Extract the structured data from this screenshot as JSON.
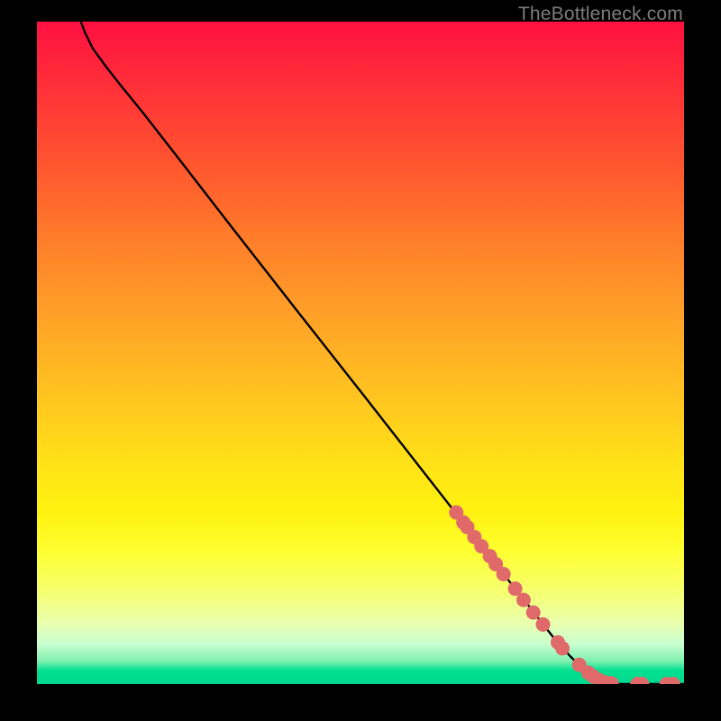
{
  "attribution": "TheBottleneck.com",
  "chart_data": {
    "type": "line",
    "title": "",
    "xlabel": "",
    "ylabel": "",
    "xlim": [
      0,
      100
    ],
    "ylim": [
      0,
      100
    ],
    "curve": {
      "name": "main-curve",
      "color": "#000000",
      "points": [
        {
          "x": 6.8,
          "y": 100.0
        },
        {
          "x": 7.4,
          "y": 98.4
        },
        {
          "x": 8.6,
          "y": 96.0
        },
        {
          "x": 10.6,
          "y": 93.3
        },
        {
          "x": 13.0,
          "y": 90.3
        },
        {
          "x": 16.5,
          "y": 86.1
        },
        {
          "x": 22.0,
          "y": 79.2
        },
        {
          "x": 30.0,
          "y": 69.1
        },
        {
          "x": 40.0,
          "y": 56.6
        },
        {
          "x": 50.0,
          "y": 44.2
        },
        {
          "x": 60.0,
          "y": 31.7
        },
        {
          "x": 70.0,
          "y": 19.2
        },
        {
          "x": 76.0,
          "y": 11.8
        },
        {
          "x": 80.0,
          "y": 6.8
        },
        {
          "x": 82.5,
          "y": 4.1
        },
        {
          "x": 84.3,
          "y": 2.4
        },
        {
          "x": 85.7,
          "y": 1.3
        },
        {
          "x": 86.9,
          "y": 0.6
        },
        {
          "x": 88.2,
          "y": 0.2
        },
        {
          "x": 90.0,
          "y": 0.0
        },
        {
          "x": 100.0,
          "y": 0.0
        }
      ]
    },
    "markers": {
      "name": "highlighted-points",
      "color": "#e06a6a",
      "radius_px": 8,
      "points": [
        {
          "x": 64.8,
          "y": 25.9
        },
        {
          "x": 65.9,
          "y": 24.4
        },
        {
          "x": 66.5,
          "y": 23.7
        },
        {
          "x": 67.6,
          "y": 22.2
        },
        {
          "x": 68.7,
          "y": 20.8
        },
        {
          "x": 70.0,
          "y": 19.3
        },
        {
          "x": 70.9,
          "y": 18.1
        },
        {
          "x": 72.1,
          "y": 16.6
        },
        {
          "x": 73.9,
          "y": 14.4
        },
        {
          "x": 75.2,
          "y": 12.7
        },
        {
          "x": 76.7,
          "y": 10.8
        },
        {
          "x": 78.2,
          "y": 9.0
        },
        {
          "x": 80.5,
          "y": 6.3
        },
        {
          "x": 81.2,
          "y": 5.4
        },
        {
          "x": 83.8,
          "y": 2.9
        },
        {
          "x": 85.2,
          "y": 1.7
        },
        {
          "x": 85.9,
          "y": 1.2
        },
        {
          "x": 86.9,
          "y": 0.6
        },
        {
          "x": 88.0,
          "y": 0.2
        },
        {
          "x": 88.8,
          "y": 0.1
        },
        {
          "x": 92.8,
          "y": 0.0
        },
        {
          "x": 93.5,
          "y": 0.0
        },
        {
          "x": 97.3,
          "y": 0.0
        },
        {
          "x": 98.3,
          "y": 0.0
        }
      ]
    }
  }
}
